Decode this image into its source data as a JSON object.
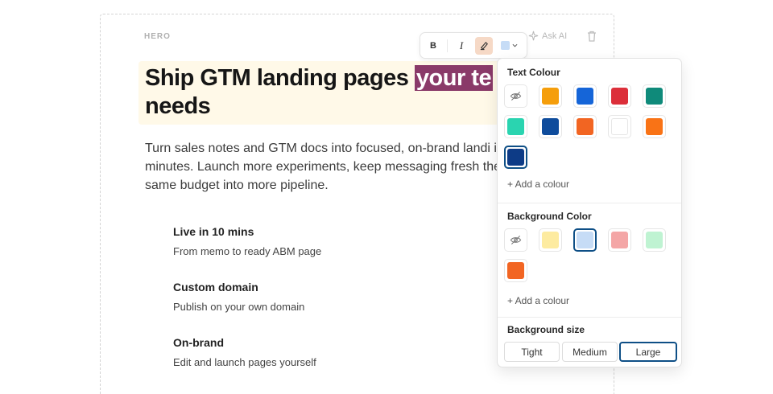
{
  "section": {
    "label": "HERO"
  },
  "header_actions": {
    "ask_ai": "Ask AI",
    "ask_ai_icon": "sparkle-icon",
    "trash_icon": "trash-icon"
  },
  "toolbar": {
    "bold_label": "B",
    "italic_label": "I",
    "highlight_icon": "highlighter-icon",
    "color_icon": "chevron-down-icon",
    "current_bg_color": "#c6dcf6"
  },
  "hero": {
    "headline_plain": "Ship GTM landing pages ",
    "headline_highlight": "your te",
    "headline_line2": "needs",
    "highlight_color": "#8a3a69",
    "lede": "Turn sales notes and GTM docs into focused, on-brand landi in minutes. Launch more experiments, keep messaging fresh the same budget into more pipeline."
  },
  "features": [
    {
      "title": "Live in 10 mins",
      "desc": "From memo to ready ABM page"
    },
    {
      "title": "Custom domain",
      "desc": "Publish on your own domain"
    },
    {
      "title": "On-brand",
      "desc": "Edit and launch pages yourself"
    }
  ],
  "popover": {
    "text_colour_title": "Text Colour",
    "text_colours": [
      "none",
      "#f59e0b",
      "#1565d8",
      "#dc2f3a",
      "#0f8a7a",
      "#2ad4b0",
      "#0f4c9c",
      "#f26522",
      "#ffffff",
      "#f97316",
      "#0d3b86"
    ],
    "text_selected_index": 10,
    "add_colour_text": "+ Add a colour",
    "bg_color_title": "Background Color",
    "bg_colours": [
      "none",
      "#fdeba0",
      "#c6dcf6",
      "#f4a6a6",
      "#bff3d2",
      "#f26522"
    ],
    "bg_selected_index": 2,
    "add_colour_bg": "+ Add a colour",
    "bg_size_title": "Background size",
    "sizes": [
      "Tight",
      "Medium",
      "Large"
    ],
    "size_selected": "Large"
  }
}
